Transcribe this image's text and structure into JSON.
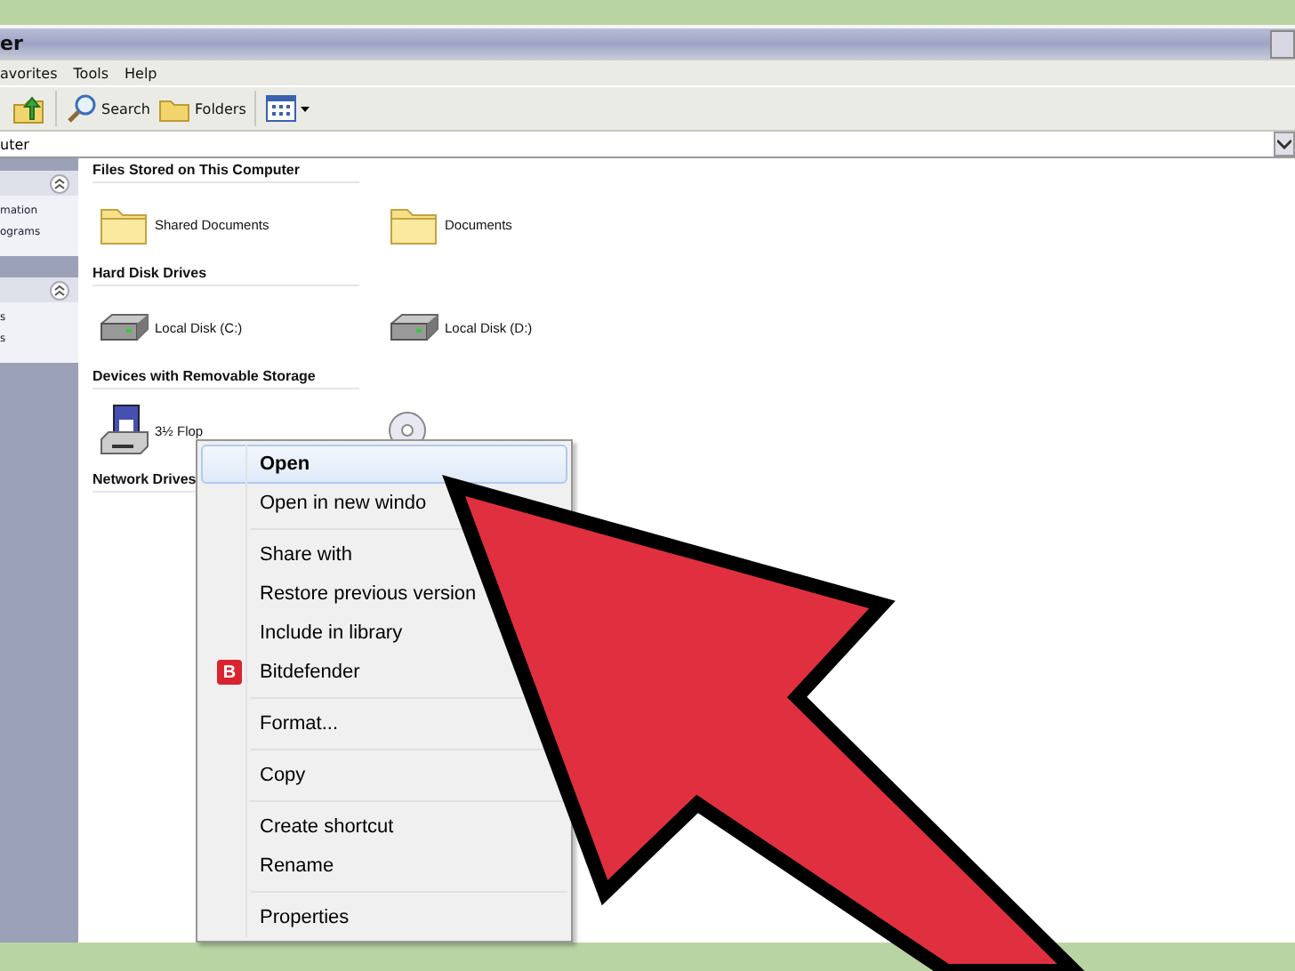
{
  "window": {
    "title": "er"
  },
  "menu_bar": [
    "avorites",
    "Tools",
    "Help"
  ],
  "toolbar": [
    {
      "kind": "up"
    },
    {
      "kind": "search",
      "label": "Search"
    },
    {
      "kind": "folders",
      "label": "Folders"
    },
    {
      "kind": "views"
    }
  ],
  "address_bar": {
    "value": "uter"
  },
  "sidebar": {
    "panels": [
      {
        "items": [
          "mation",
          "ograms"
        ]
      },
      {
        "items": [
          "s",
          "s"
        ]
      }
    ]
  },
  "sections": [
    {
      "heading": "Files Stored on This Computer",
      "items": [
        {
          "kind": "folder",
          "label": "Shared Documents"
        },
        {
          "kind": "folder",
          "label": "Documents"
        }
      ]
    },
    {
      "heading": "Hard Disk Drives",
      "items": [
        {
          "kind": "disk",
          "label": "Local Disk (C:)"
        },
        {
          "kind": "disk",
          "label": "Local Disk (D:)"
        }
      ]
    },
    {
      "heading": "Devices with Removable Storage",
      "items": [
        {
          "kind": "floppy",
          "label": "3½ Flop"
        },
        {
          "kind": "cd"
        }
      ]
    },
    {
      "heading": "Network Drives"
    }
  ],
  "context_menu": [
    [
      {
        "label": "Open",
        "selected": true,
        "default": true
      },
      {
        "label": "Open in new windo",
        "selected": false,
        "default": false
      }
    ],
    [
      {
        "label": "Share with",
        "selected": false,
        "default": false
      },
      {
        "label": "Restore previous version",
        "selected": false,
        "default": false
      },
      {
        "label": "Include in library",
        "selected": false,
        "default": false
      },
      {
        "label": "Bitdefender",
        "selected": false,
        "default": false,
        "icon": "B"
      }
    ],
    [
      {
        "label": "Format...",
        "selected": false,
        "default": false
      }
    ],
    [
      {
        "label": "Copy",
        "selected": false,
        "default": false
      }
    ],
    [
      {
        "label": "Create shortcut",
        "selected": false,
        "default": false
      },
      {
        "label": "Rename",
        "selected": false,
        "default": false
      }
    ],
    [
      {
        "label": "Properties",
        "selected": false,
        "default": false
      }
    ]
  ]
}
